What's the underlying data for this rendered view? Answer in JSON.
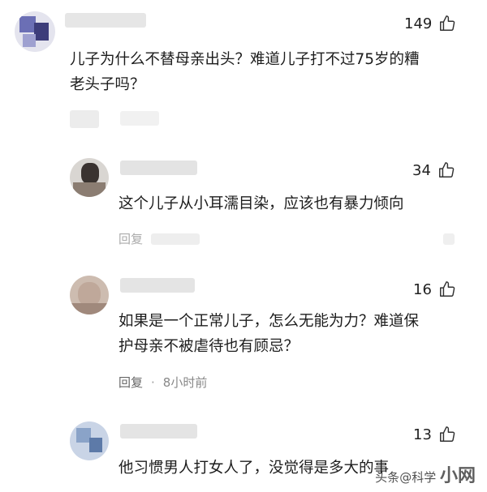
{
  "comments": [
    {
      "likes": "149",
      "text_lines": [
        "儿子为什么不替母亲出头？难道儿子打不过75岁的糟",
        "老头子吗？"
      ]
    },
    {
      "likes": "34",
      "text_lines": [
        "这个儿子从小耳濡目染，应该也有暴力倾向"
      ],
      "meta_partial": "回复"
    },
    {
      "likes": "16",
      "text_lines": [
        "如果是一个正常儿子，怎么无能为力？难道保",
        "护母亲不被虐待也有顾忌？"
      ],
      "reply_label": "回复",
      "dot": "·",
      "time": "8小时前"
    },
    {
      "likes": "13",
      "text_lines": [
        "他习惯男人打女人了，没觉得是多大的事"
      ]
    }
  ],
  "watermark": {
    "prefix": "头条",
    "text": "@科学",
    "suffix": "小网"
  },
  "colors": {
    "text": "#1d1d1d",
    "meta": "#666666",
    "avatar1": "#6b6fb5",
    "avatar2": "#3a3330",
    "avatar3": "#bfa89a",
    "avatar4": "#8aa3c8"
  },
  "icons": [
    "thumbs-up-icon"
  ]
}
